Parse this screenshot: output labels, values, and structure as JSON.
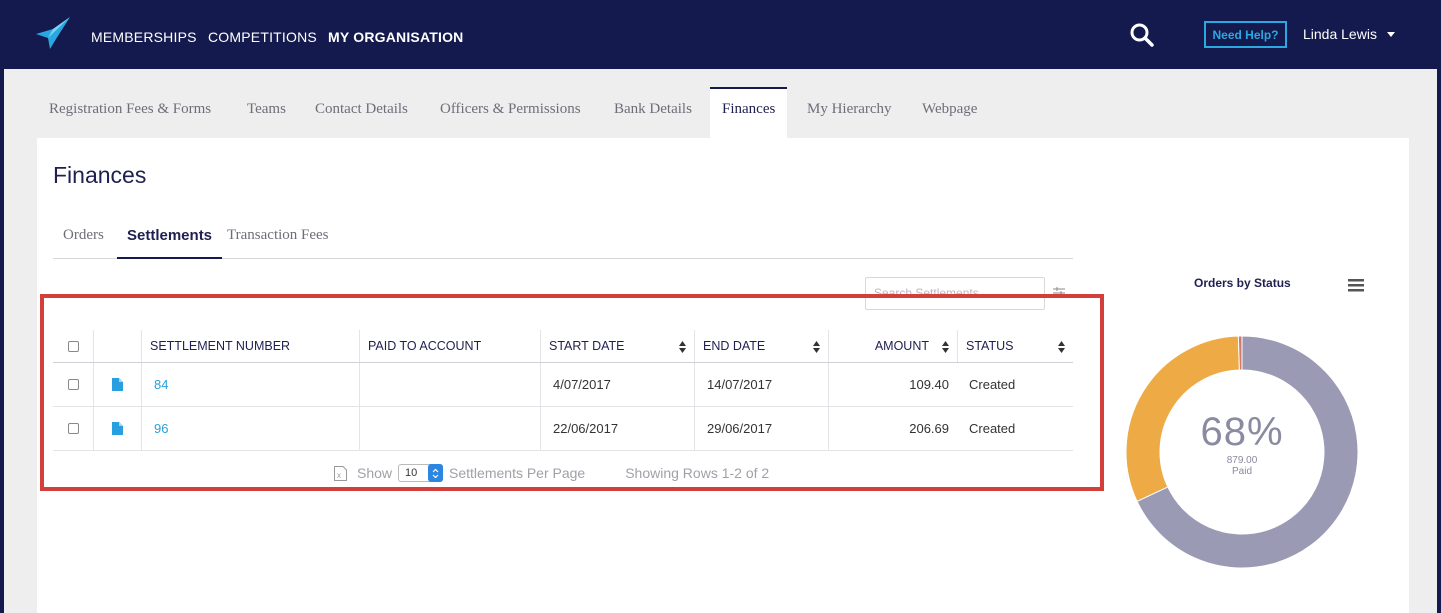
{
  "nav": {
    "items": [
      "MEMBERSHIPS",
      "COMPETITIONS",
      "MY ORGANISATION"
    ],
    "help_label": "Need Help?",
    "user_name": "Linda Lewis"
  },
  "page_tabs": [
    "Registration Fees & Forms",
    "Teams",
    "Contact Details",
    "Officers & Permissions",
    "Bank Details",
    "Finances",
    "My Hierarchy",
    "Webpage"
  ],
  "panel": {
    "title": "Finances",
    "subtabs": [
      "Orders",
      "Settlements",
      "Transaction Fees"
    ],
    "search_placeholder": "Search Settlements"
  },
  "table": {
    "headers": [
      "SETTLEMENT NUMBER",
      "PAID TO ACCOUNT",
      "START DATE",
      "END DATE",
      "AMOUNT",
      "STATUS"
    ],
    "rows": [
      {
        "number": "84",
        "account": "",
        "start": "4/07/2017",
        "end": "14/07/2017",
        "amount": "109.40",
        "status": "Created"
      },
      {
        "number": "96",
        "account": "",
        "start": "22/06/2017",
        "end": "29/06/2017",
        "amount": "206.69",
        "status": "Created"
      }
    ]
  },
  "pager": {
    "show_label": "Show",
    "per_page": "10",
    "per_page_label": "Settlements Per Page",
    "rows_label": "Showing Rows 1-2 of 2"
  },
  "chart": {
    "title": "Orders by Status",
    "center_pct": "68%",
    "center_value": "879.00",
    "center_label": "Paid"
  },
  "chart_data": {
    "type": "pie",
    "title": "Orders by Status",
    "slices": [
      {
        "label": "Paid",
        "value": 68,
        "color": "#9a9ab4"
      },
      {
        "label": "",
        "value": 31.5,
        "color": "#eeaa44"
      },
      {
        "label": "",
        "value": 0.5,
        "color": "#d07a6a"
      }
    ]
  },
  "colors": {
    "nav_bg": "#141a4e",
    "accent": "#2aa9e0",
    "highlight": "#d33f3a"
  }
}
